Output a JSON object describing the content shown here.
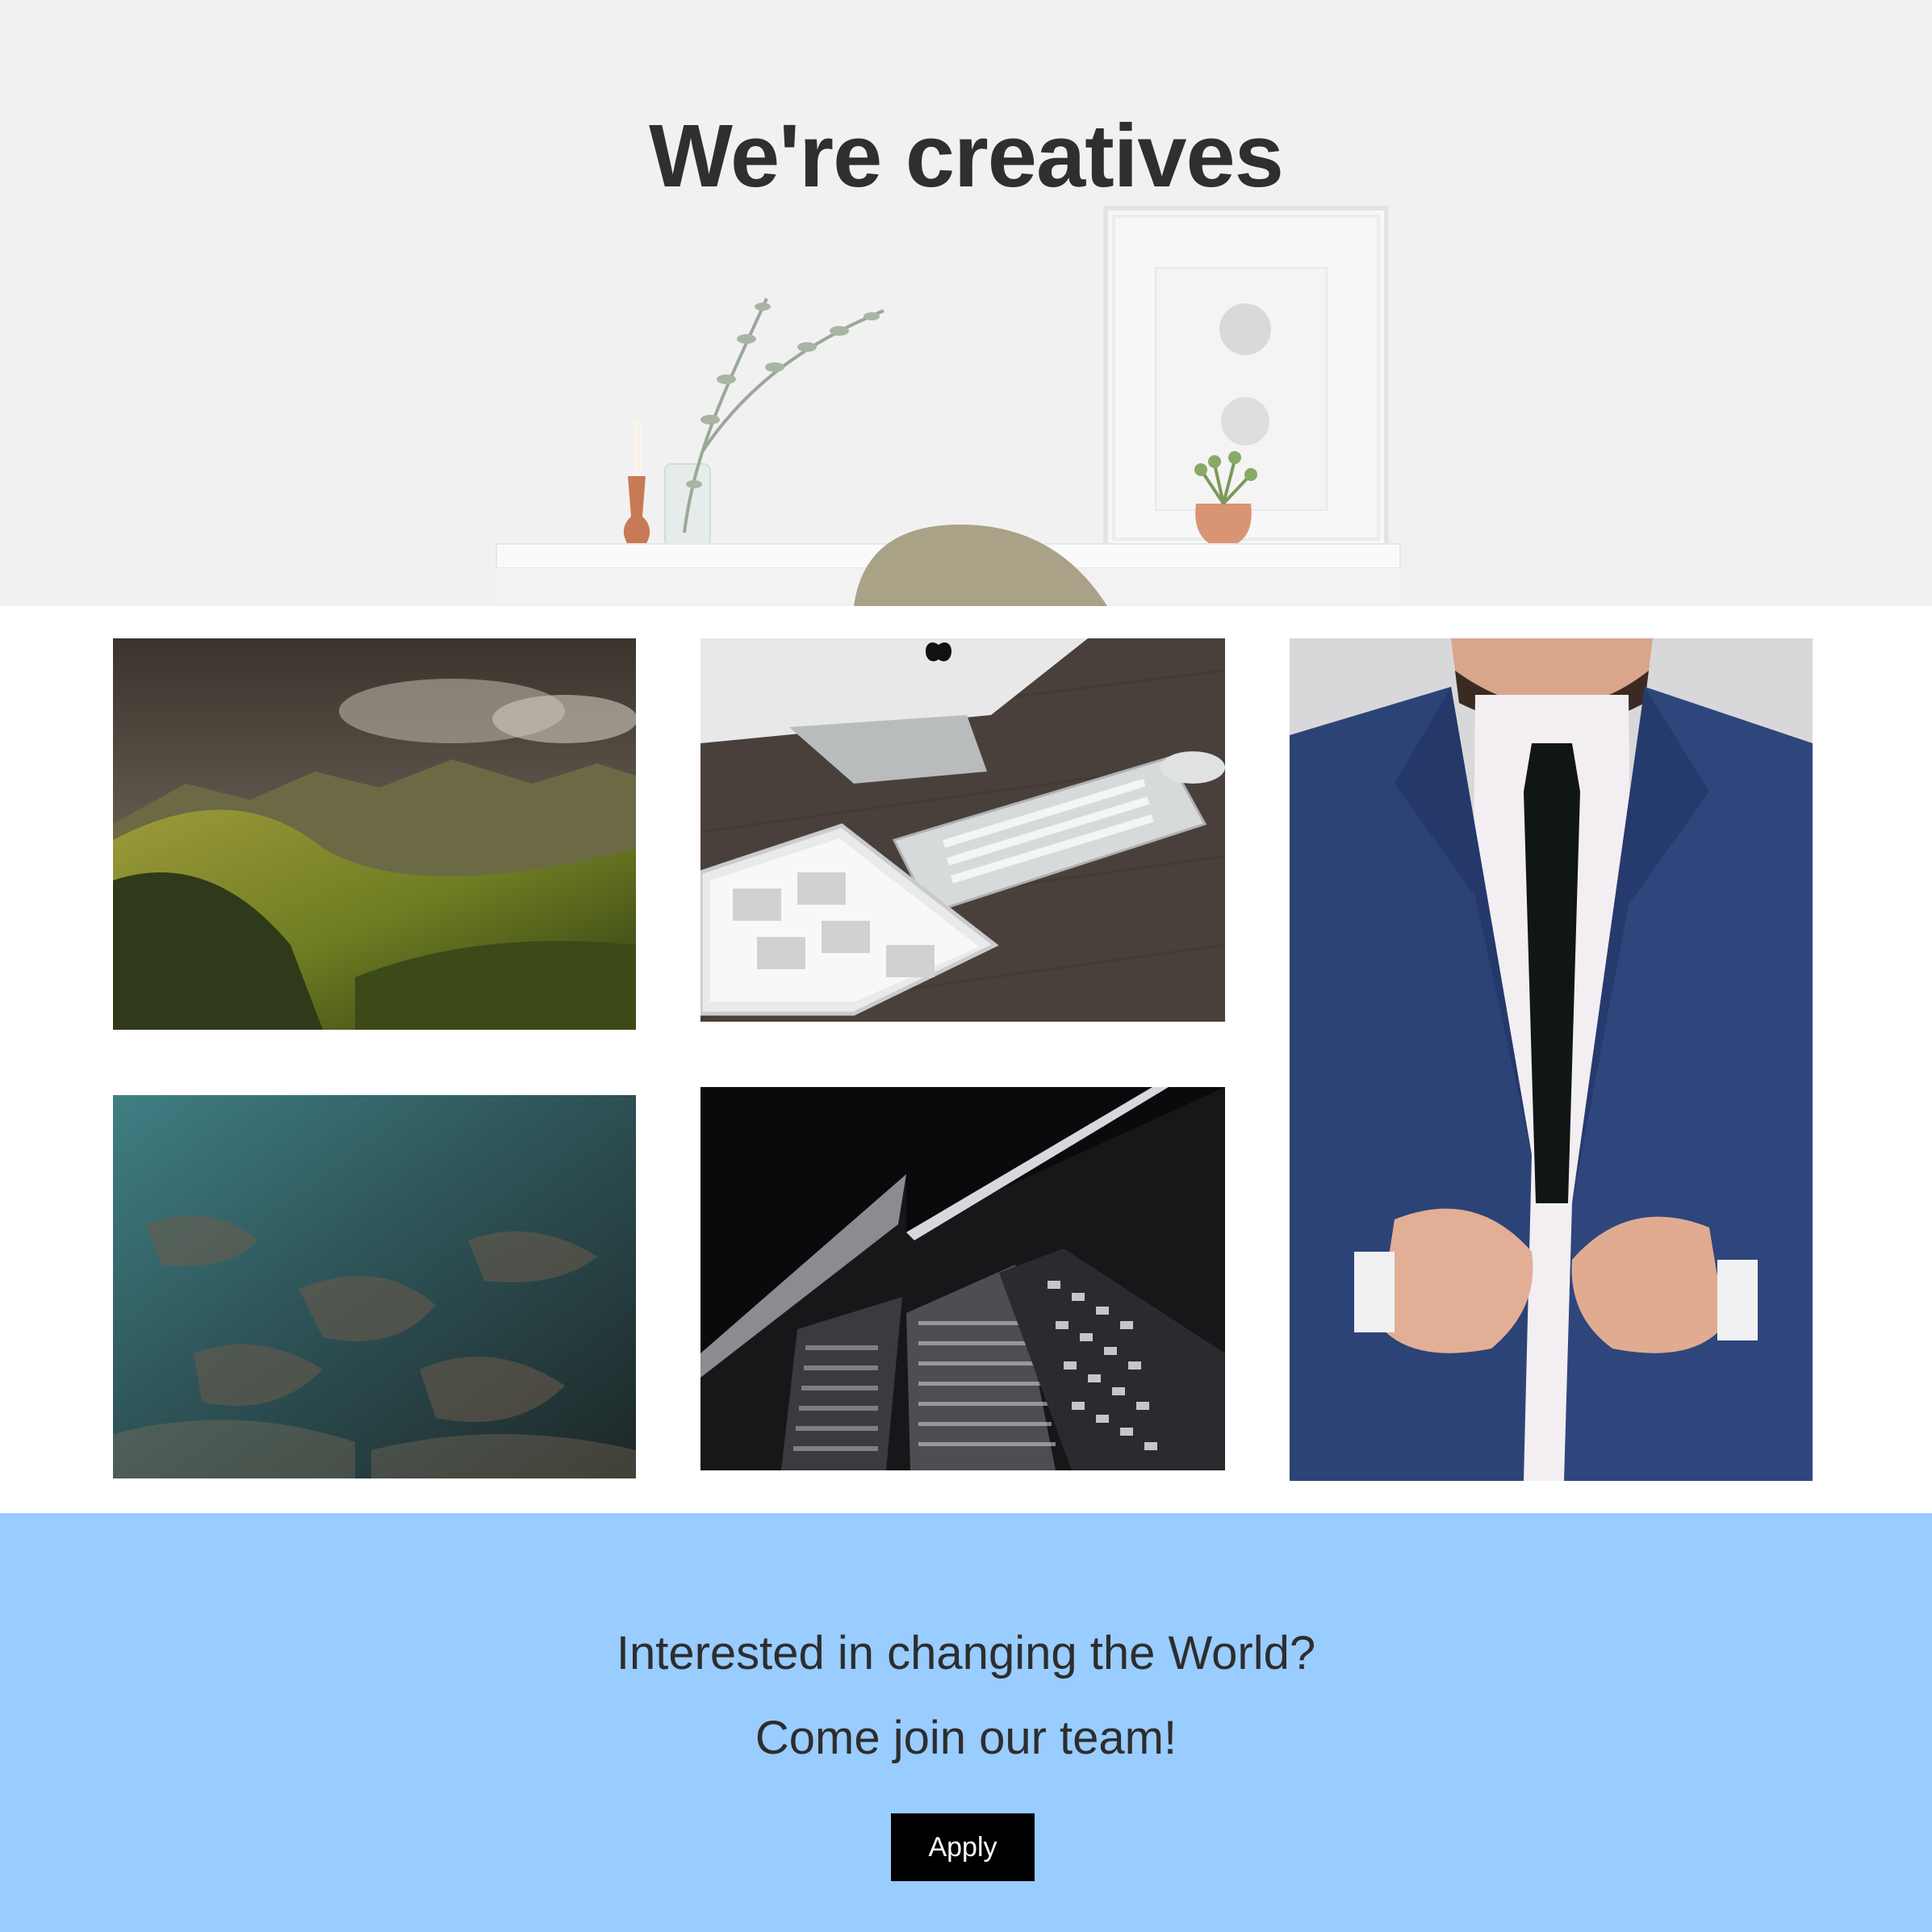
{
  "hero": {
    "title": "We're creatives"
  },
  "gallery": {
    "images": [
      {
        "name": "mountain-valley-photo"
      },
      {
        "name": "desk-keyboard-tablet-photo"
      },
      {
        "name": "man-in-suit-photo"
      },
      {
        "name": "aerial-landscape-photo"
      },
      {
        "name": "skyscraper-photo"
      }
    ]
  },
  "cta": {
    "line_1": "Interested in changing the World?",
    "line_2": "Come join our team!",
    "button_label": "Apply",
    "background_color": "#99ccff",
    "button_color": "#000000"
  }
}
